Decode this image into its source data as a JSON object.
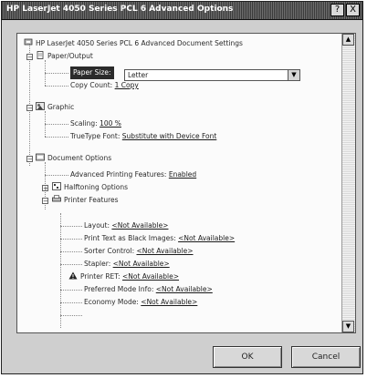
{
  "window": {
    "title": "HP LaserJet 4050 Series PCL 6 Advanced Options",
    "help_glyph": "?",
    "close_glyph": "X"
  },
  "tree": {
    "root_label": "HP LaserJet 4050 Series PCL 6 Advanced Document Settings",
    "paper_output": {
      "label": "Paper/Output",
      "paper_size_label": "Paper Size:",
      "paper_size_value": "Letter",
      "copy_count_label": "Copy Count:",
      "copy_count_value": "1 Copy"
    },
    "graphic": {
      "label": "Graphic",
      "scaling_label": "Scaling:",
      "scaling_value": "100 %",
      "truetype_label": "TrueType Font:",
      "truetype_value": "Substitute with Device Font"
    },
    "document_options": {
      "label": "Document Options",
      "adv_printing_label": "Advanced Printing Features:",
      "adv_printing_value": "Enabled",
      "halftoning_label": "Halftoning Options",
      "printer_features_label": "Printer Features",
      "features": [
        {
          "label": "Layout:",
          "value": "<Not Available>"
        },
        {
          "label": "Print Text as Black Images:",
          "value": "<Not Available>"
        },
        {
          "label": "Sorter Control:",
          "value": "<Not Available>"
        },
        {
          "label": "Stapler:",
          "value": "<Not Available>"
        },
        {
          "label": "Printer RET:",
          "value": "<Not Available>"
        },
        {
          "label": "Preferred Mode Info:",
          "value": "<Not Available>"
        },
        {
          "label": "Economy Mode:",
          "value": "<Not Available>"
        }
      ]
    },
    "combo_arrow_glyph": "▼",
    "scroll_up_glyph": "▲",
    "scroll_down_glyph": "▼",
    "expander_collapse": "−",
    "expander_expand": "+"
  },
  "buttons": {
    "ok_label": "OK",
    "cancel_label": "Cancel"
  },
  "icons": {
    "root": "printer-settings-icon",
    "paper_output": "paper-output-icon",
    "graphic": "graphic-icon",
    "document_options": "document-options-icon",
    "halftoning": "halftoning-icon",
    "printer_features": "printer-features-icon",
    "warning": "warning-icon"
  }
}
